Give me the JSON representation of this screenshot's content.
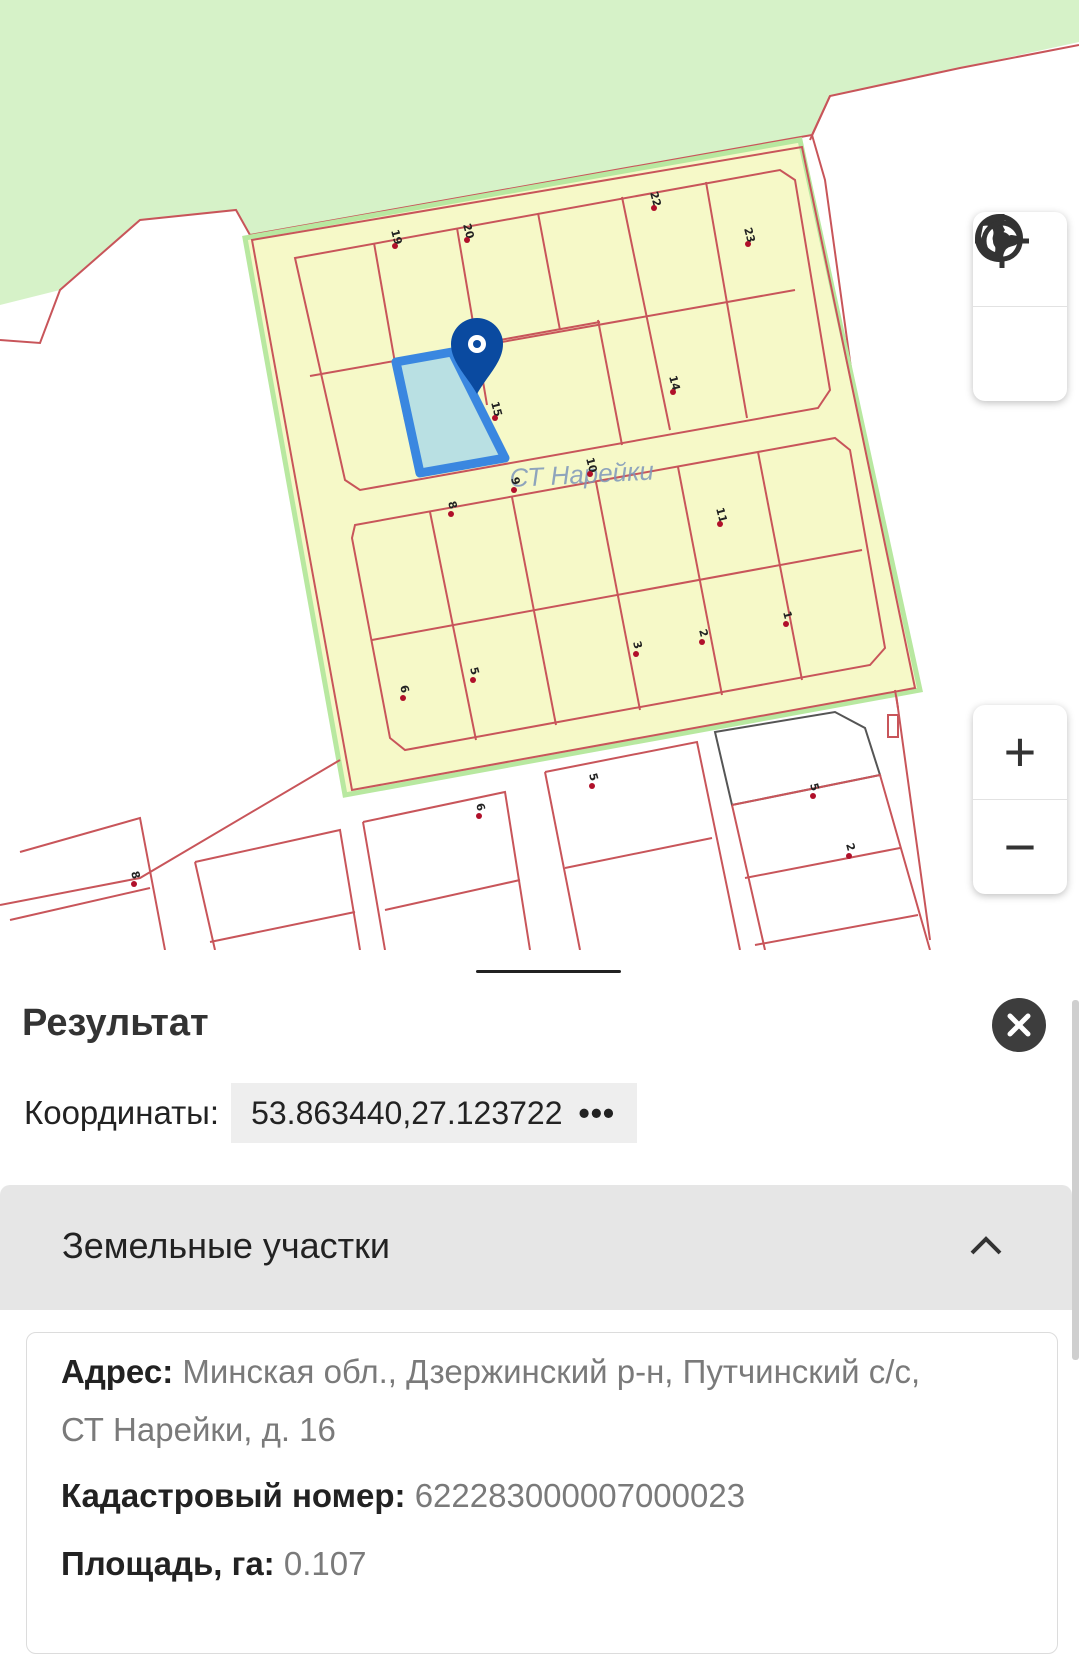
{
  "map": {
    "settlement_label": "СТ Нарейки",
    "plot_numbers": [
      "19",
      "20",
      "22",
      "23",
      "14",
      "15",
      "10",
      "9",
      "8",
      "11",
      "1",
      "2",
      "3",
      "5",
      "6",
      "5",
      "6",
      "8",
      "5",
      "2"
    ],
    "selected_plot_color": "#3a87e0",
    "marker_color": "#0a4aa0",
    "controls": {
      "layers": "globe-icon",
      "locate": "crosshair-icon",
      "zoom_in": "+",
      "zoom_out": "−"
    }
  },
  "result": {
    "title": "Результат",
    "coordinates_label": "Координаты:",
    "coordinates_value": "53.863440,27.123722",
    "more": "•••"
  },
  "section": {
    "title": "Земельные участки",
    "address_label": "Адрес:",
    "address_value": "Минская обл., Дзержинский р-н, Путчинский с/с,",
    "address_value_2": "СТ Нарейки, д. 16",
    "cadastral_label": "Кадастровый номер:",
    "cadastral_value": "622283000007000023",
    "area_label": "Площадь, га:",
    "area_value": "0.107"
  }
}
